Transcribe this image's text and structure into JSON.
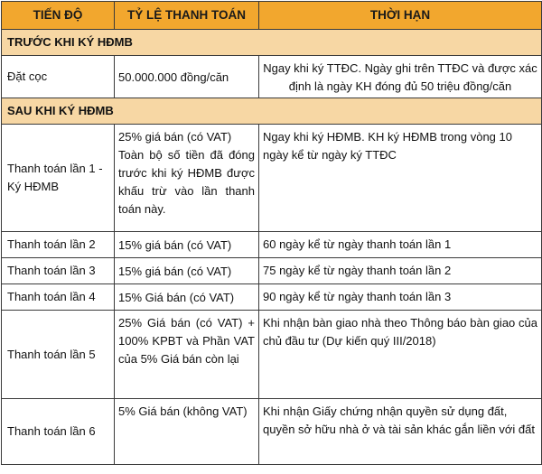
{
  "headers": {
    "stage": "TIẾN ĐỘ",
    "rate": "TỶ LỆ THANH TOÁN",
    "term": "THỜI HẠN"
  },
  "sections": {
    "before": "TRƯỚC KHI KÝ HĐMB",
    "after": "SAU KHI KÝ HĐMB"
  },
  "rows": [
    {
      "stage": "Đặt cọc",
      "rate": "50.000.000 đồng/căn",
      "term": "Ngay khi ký TTĐC. Ngày ghi trên TTĐC và được xác định là ngày KH đóng đủ 50 triệu đồng/căn"
    },
    {
      "stage": "Thanh toán lần 1 - Ký HĐMB",
      "rate": "25% giá bán (có VAT)",
      "rate_note": "Toàn bộ số tiền đã đóng trước khi ký HĐMB được khấu trừ vào lần thanh toán này.",
      "term": "Ngay khi ký HĐMB. KH ký HĐMB trong vòng 10 ngày kể từ ngày ký TTĐC"
    },
    {
      "stage": "Thanh toán lần 2",
      "rate": "15% giá bán (có VAT)",
      "term": "60 ngày kể từ ngày thanh toán lần 1"
    },
    {
      "stage": "Thanh toán lần 3",
      "rate": "15% giá bán (có VAT)",
      "term": "75 ngày kể từ ngày thanh toán lần 2"
    },
    {
      "stage": "Thanh toán lần 4",
      "rate": "15% Giá bán (có VAT)",
      "term": "90 ngày kể từ ngày thanh toán lần 3"
    },
    {
      "stage": "Thanh toán lần 5",
      "rate": "25% Giá bán (có VAT) + 100% KPBT và Phần VAT của 5% Giá bán còn lại",
      "term": "Khi nhận bàn giao nhà theo Thông báo bàn giao của chủ đầu tư (Dự kiến quý III/2018)"
    },
    {
      "stage": "Thanh toán lần 6",
      "rate": "5% Giá bán (không VAT)",
      "term": "Khi nhận Giấy chứng nhận quyền sử dụng đất, quyền sở hữu nhà ở và tài sản khác gắn liền với đất"
    }
  ]
}
